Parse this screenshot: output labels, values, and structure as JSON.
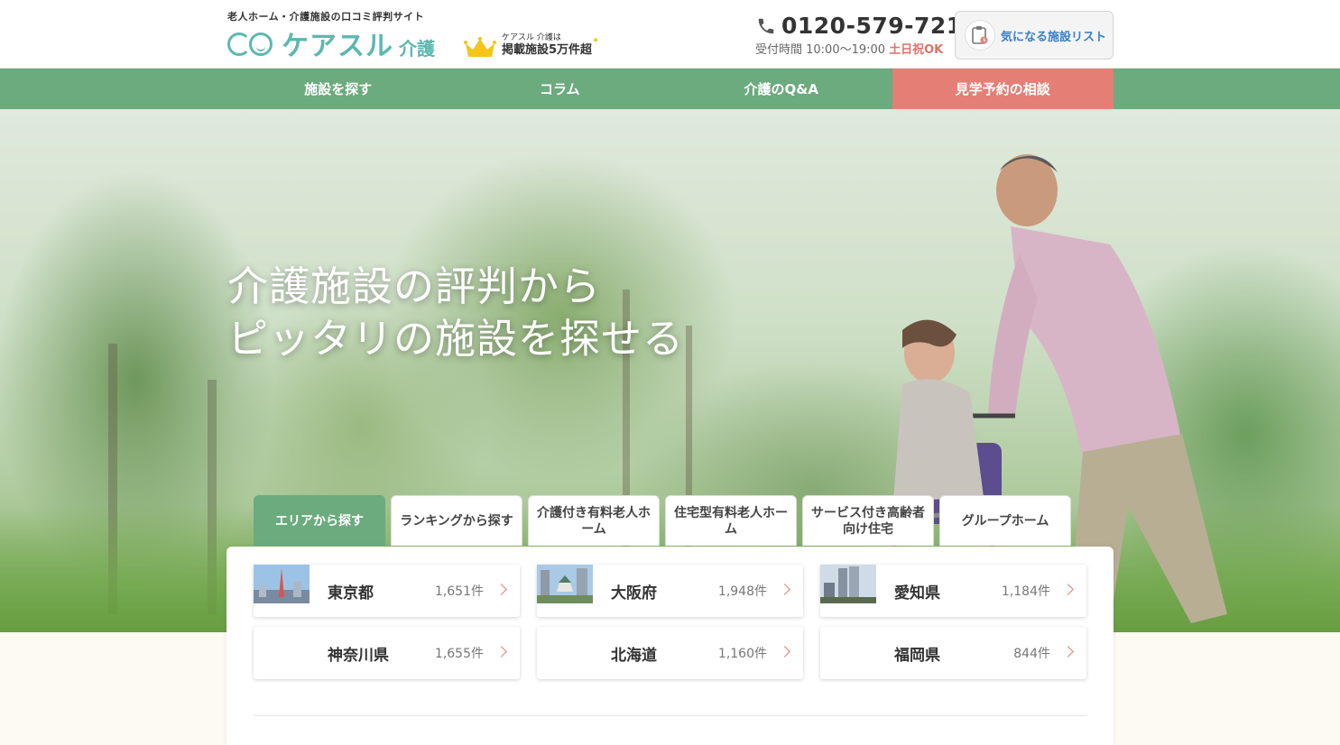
{
  "header": {
    "tagline": "老人ホーム・介護施設の口コミ評判サイト",
    "logo_text": "ケアスル",
    "logo_sub": "介護",
    "badge_small": "ケアスル 介護は",
    "badge_big": "掲載施設5万件超",
    "phone": "0120-579-721",
    "hours": "受付時間 10:00〜19:00",
    "hours_ok": "土日祝OK",
    "favorites_label": "気になる施設リスト"
  },
  "nav": {
    "items": [
      {
        "label": "施設を探す"
      },
      {
        "label": "コラム"
      },
      {
        "label": "介護のQ&A"
      },
      {
        "label": "見学予約の相談"
      }
    ]
  },
  "hero": {
    "headline_line1": "介護施設の評判から",
    "headline_line2": "ピッタリの施設を探せる"
  },
  "tabs": [
    {
      "label": "エリアから探す",
      "active": true
    },
    {
      "label": "ランキングから探す"
    },
    {
      "label": "介護付き有料老人ホーム"
    },
    {
      "label": "住宅型有料老人ホーム"
    },
    {
      "label": "サービス付き高齢者向け住宅"
    },
    {
      "label": "グループホーム"
    }
  ],
  "areas": [
    {
      "name": "東京都",
      "count": "1,651件"
    },
    {
      "name": "大阪府",
      "count": "1,948件"
    },
    {
      "name": "愛知県",
      "count": "1,184件"
    },
    {
      "name": "神奈川県",
      "count": "1,655件"
    },
    {
      "name": "北海道",
      "count": "1,160件"
    },
    {
      "name": "福岡県",
      "count": "844件"
    }
  ],
  "colors": {
    "brand_teal": "#5bb8b0",
    "nav_green": "#6bab7d",
    "cta_coral": "#e57f76",
    "link_blue": "#3a7fc4"
  }
}
